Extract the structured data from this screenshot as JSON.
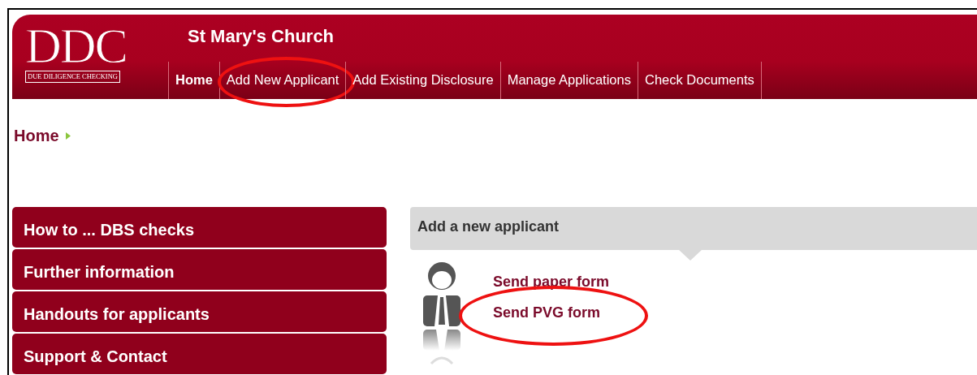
{
  "header": {
    "logo": {
      "letters": "DDC",
      "tagline": "DUE DILIGENCE CHECKING"
    },
    "title": "St Mary's Church"
  },
  "nav": [
    {
      "label": "Home",
      "selected": true,
      "circled": false
    },
    {
      "label": "Add New Applicant",
      "selected": false,
      "circled": true
    },
    {
      "label": "Add Existing Disclosure",
      "selected": false,
      "circled": false
    },
    {
      "label": "Manage Applications",
      "selected": false,
      "circled": false
    },
    {
      "label": "Check Documents",
      "selected": false,
      "circled": false
    }
  ],
  "breadcrumb": [
    "Home"
  ],
  "sidebar": {
    "items": [
      {
        "label": "How to ... DBS checks"
      },
      {
        "label": "Further information"
      },
      {
        "label": "Handouts for applicants"
      },
      {
        "label": "Support & Contact"
      }
    ]
  },
  "panel": {
    "title": "Add a new applicant",
    "links": [
      {
        "label": "Send paper form",
        "circled": false
      },
      {
        "label": "Send PVG form",
        "circled": true
      }
    ]
  }
}
